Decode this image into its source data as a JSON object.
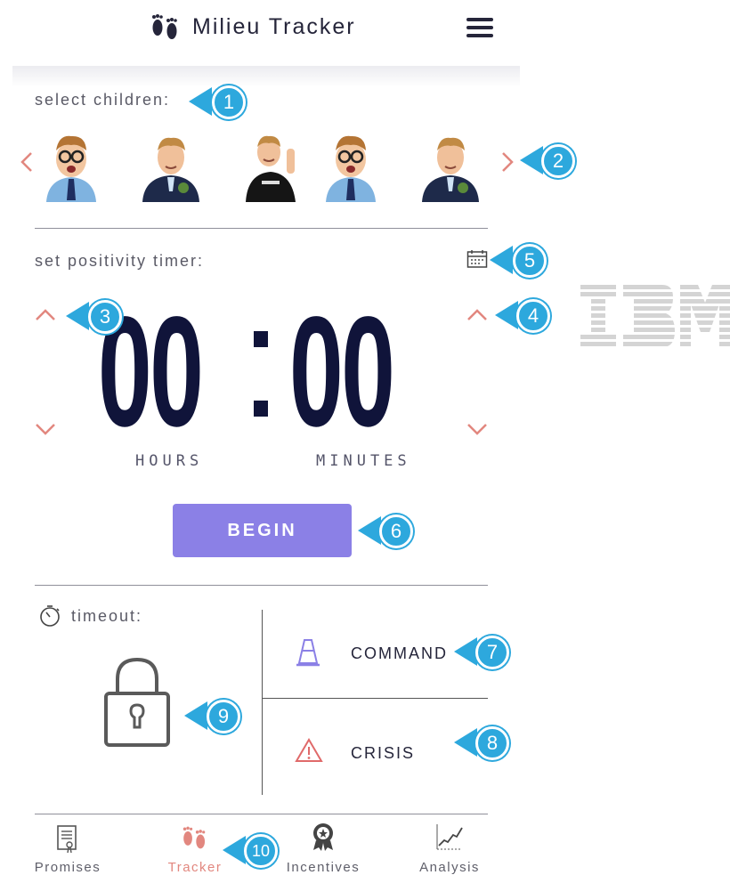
{
  "app": {
    "title": "Milieu Tracker"
  },
  "children": {
    "label": "select children:",
    "avatars": [
      {
        "name": "child-1"
      },
      {
        "name": "child-2"
      },
      {
        "name": "child-3"
      },
      {
        "name": "child-4"
      },
      {
        "name": "child-5"
      }
    ]
  },
  "timer": {
    "label": "set positivity timer:",
    "hours": "00",
    "minutes": "00",
    "hours_label": "HOURS",
    "minutes_label": "MINUTES",
    "begin_label": "BEGIN"
  },
  "timeout": {
    "label": "timeout:"
  },
  "options": {
    "command_label": "COMMAND",
    "crisis_label": "CRISIS"
  },
  "bottom_nav": {
    "items": [
      {
        "label": "Promises",
        "icon": "certificate-icon"
      },
      {
        "label": "Tracker",
        "icon": "footprints-icon"
      },
      {
        "label": "Incentives",
        "icon": "award-icon"
      },
      {
        "label": "Analysis",
        "icon": "chart-icon"
      }
    ],
    "active": "Tracker"
  },
  "callouts": [
    "1",
    "2",
    "3",
    "4",
    "5",
    "6",
    "7",
    "8",
    "9",
    "10"
  ],
  "watermark": "IBM",
  "colors": {
    "accent": "#8b80e6",
    "chevron": "#e2877f",
    "digits": "#10143a",
    "callout": "#2da8dd",
    "active_nav": "#e2877f"
  }
}
